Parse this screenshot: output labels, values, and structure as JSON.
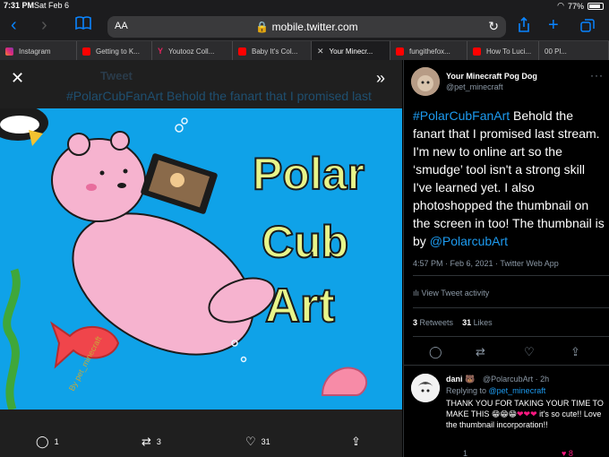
{
  "status": {
    "time": "7:31 PM",
    "date": "Sat Feb 6",
    "battery": "77%"
  },
  "toolbar": {
    "url": "mobile.twitter.com",
    "aa": "AA"
  },
  "tabs": [
    {
      "label": "Instagram",
      "icon": "instagram"
    },
    {
      "label": "Getting to K...",
      "icon": "youtube"
    },
    {
      "label": "Youtooz Coll...",
      "icon": "youtooz"
    },
    {
      "label": "Baby It's Col...",
      "icon": "youtube"
    },
    {
      "label": "Your Minecr...",
      "icon": "close",
      "active": true
    },
    {
      "label": "fungithefox...",
      "icon": "youtube"
    },
    {
      "label": "How To Luci...",
      "icon": "youtube"
    },
    {
      "label": "00 Pl...",
      "icon": ""
    }
  ],
  "media": {
    "ghost_header": "Tweet",
    "ghost_text": "#PolarCubFanArt Behold the fanart that I promised last",
    "art_title": [
      "Polar",
      "Cub",
      "Art"
    ],
    "art_signature": "By pet_minecraft",
    "actions": {
      "replies": "1",
      "retweets": "3",
      "likes": "31"
    }
  },
  "tweet": {
    "author_name": "Your Minecraft Pog Dog",
    "author_handle": "@pet_minecraft",
    "hashtag": "#PolarCubFanArt",
    "body": " Behold the fanart that I promised last stream. I'm new to online art so the ‘smudge’ tool isn't a strong skill I've learned yet. I also photoshopped the thumbnail on the screen in too! The thumbnail is by ",
    "mention": "@PolarcubArt",
    "meta": "4:57 PM · Feb 6, 2021 · Twitter Web App",
    "activity": "View Tweet activity",
    "retweets_count": "3",
    "retweets_label": "Retweets",
    "likes_count": "31",
    "likes_label": "Likes"
  },
  "reply": {
    "name": "dani",
    "handle": "@PolarcubArt · 2h",
    "replying_to_label": "Replying to ",
    "replying_to": "@pet_minecraft",
    "text_1": "THANK YOU FOR TAKING YOUR TIME TO MAKE THIS ",
    "emojis": "😁😁😁",
    "hearts": "❤❤❤",
    "text_2": " it's so cute!! Love the thumbnail incorporation!!",
    "reply_count": "1",
    "like_count": "8"
  },
  "colors": {
    "accent": "#1d9bf0",
    "safari_blue": "#0a84ff",
    "art_bg": "#0fa2e8",
    "bear": "#f6b3cf",
    "title_fill": "#e8f58a"
  }
}
